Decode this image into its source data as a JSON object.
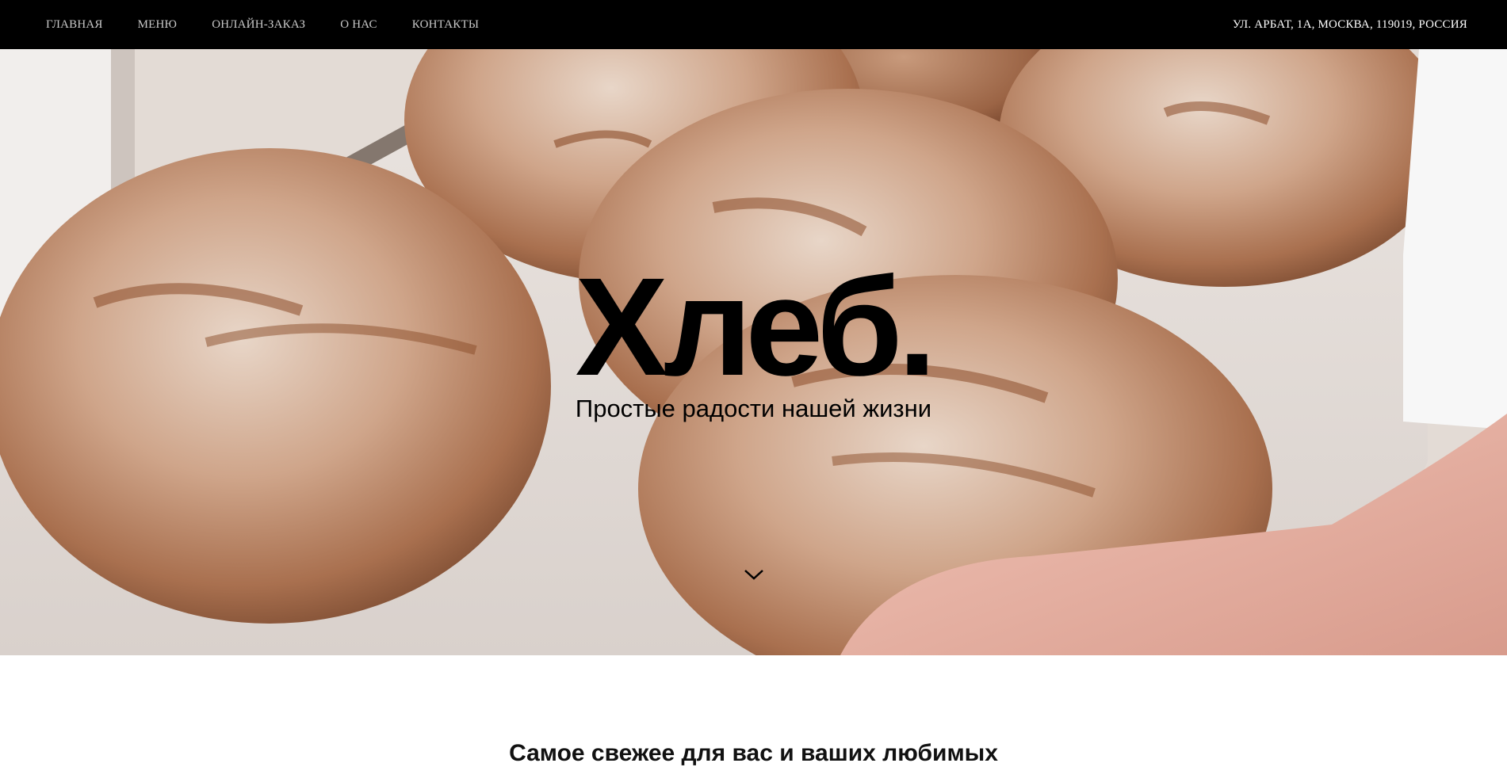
{
  "nav": {
    "items": [
      {
        "label": "ГЛАВНАЯ"
      },
      {
        "label": "МЕНЮ"
      },
      {
        "label": "ОНЛАЙН-ЗАКАЗ"
      },
      {
        "label": "О НАС"
      },
      {
        "label": "КОНТАКТЫ"
      }
    ],
    "address": "УЛ. АРБАТ, 1А, МОСКВА, 119019, РОССИЯ"
  },
  "hero": {
    "title": "Хлеб.",
    "subtitle": "Простые радости нашей жизни",
    "scroll_icon": "chevron-down-icon"
  },
  "section": {
    "heading": "Самое свежее для вас и ваших любимых"
  },
  "colors": {
    "topbar": "#000000",
    "nav_text": "#c9c9c9",
    "address_text": "#ffffff",
    "title_text": "#000000"
  }
}
